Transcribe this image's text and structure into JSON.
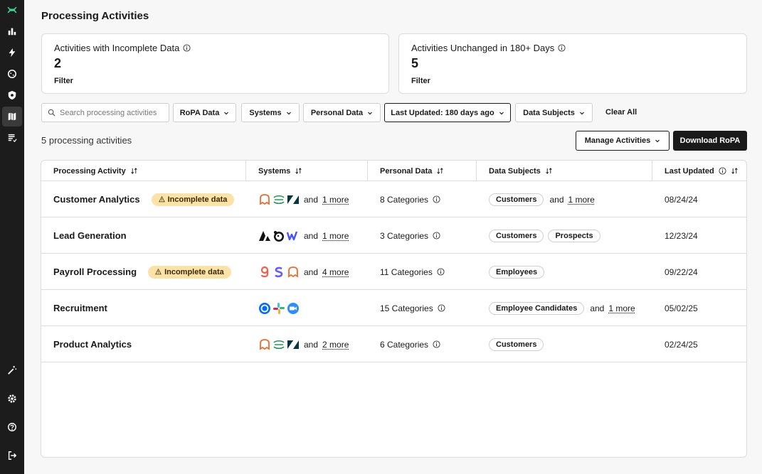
{
  "page": {
    "title": "Processing Activities"
  },
  "cards": [
    {
      "label": "Activities with Incomplete Data",
      "count": "2",
      "filter": "Filter"
    },
    {
      "label": "Activities Unchanged in 180+ Days",
      "count": "5",
      "filter": "Filter"
    }
  ],
  "filters": {
    "search_placeholder": "Search processing activities",
    "ropa_data": "RoPA Data",
    "systems": "Systems",
    "personal_data": "Personal Data",
    "last_updated": "Last Updated: 180 days ago",
    "data_subjects": "Data Subjects",
    "clear_all": "Clear All"
  },
  "summary": {
    "count_text": "5 processing activities",
    "manage_label": "Manage Activities",
    "download_label": "Download RoPA"
  },
  "table": {
    "headers": {
      "activity": "Processing Activity",
      "systems": "Systems",
      "personal_data": "Personal Data",
      "data_subjects": "Data Subjects",
      "last_updated": "Last Updated"
    },
    "rows": [
      {
        "name": "Customer Analytics",
        "badge": "Incomplete data",
        "systems_icons": [
          "segment-icon",
          "sigma-icon",
          "zendesk-icon"
        ],
        "systems_and": "and",
        "systems_more": "1 more",
        "personal_data": "8 Categories",
        "subjects": [
          "Customers"
        ],
        "subjects_and": "and",
        "subjects_more": "1 more",
        "updated": "08/24/24"
      },
      {
        "name": "Lead Generation",
        "badge": "",
        "systems_icons": [
          "apollo-icon",
          "mailchimp-icon",
          "webflow-icon"
        ],
        "systems_and": "and",
        "systems_more": "1 more",
        "personal_data": "3 Categories",
        "subjects": [
          "Customers",
          "Prospects"
        ],
        "subjects_and": "",
        "subjects_more": "",
        "updated": "12/23/24"
      },
      {
        "name": "Payroll Processing",
        "badge": "Incomplete data",
        "systems_icons": [
          "gusto-icon",
          "stripe-icon",
          "segment-icon"
        ],
        "systems_and": "and",
        "systems_more": "4 more",
        "personal_data": "11 Categories",
        "subjects": [
          "Employees"
        ],
        "subjects_and": "",
        "subjects_more": "",
        "updated": "09/22/24"
      },
      {
        "name": "Recruitment",
        "badge": "",
        "systems_icons": [
          "calendly-icon",
          "slack-icon",
          "zoom-icon"
        ],
        "systems_and": "",
        "systems_more": "",
        "personal_data": "15 Categories",
        "subjects": [
          "Employee Candidates"
        ],
        "subjects_and": "and",
        "subjects_more": "1 more",
        "updated": "05/02/25"
      },
      {
        "name": "Product Analytics",
        "badge": "",
        "systems_icons": [
          "segment-icon",
          "sigma-icon",
          "zendesk-icon"
        ],
        "systems_and": "and",
        "systems_more": "2 more",
        "personal_data": "6 Categories",
        "subjects": [
          "Customers"
        ],
        "subjects_and": "",
        "subjects_more": "",
        "updated": "02/24/25"
      }
    ]
  },
  "colors": {
    "sidebar_bg": "#1c1c1c",
    "brand_green": "#3ddc97",
    "badge_bg": "#fbe2a6",
    "primary_dark": "#1a1a1a"
  }
}
